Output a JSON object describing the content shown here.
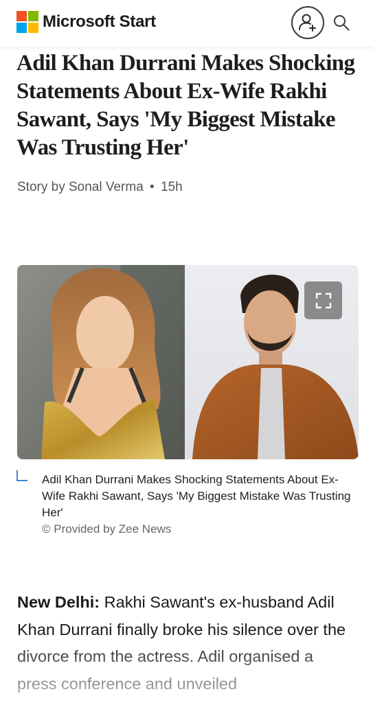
{
  "header": {
    "brand": "Microsoft Start",
    "logo_colors": [
      "#f25022",
      "#7fba00",
      "#00a4ef",
      "#ffb900"
    ],
    "account_icon": "add-account-icon",
    "search_icon": "search-icon"
  },
  "article": {
    "headline": "Adil Khan Durrani Makes Shocking Statements About Ex-Wife Rakhi Sawant, Says 'My Biggest Mistake Was Trusting Her'",
    "byline": {
      "author": "Story by Sonal Verma",
      "separator": "•",
      "age": "15h"
    },
    "image": {
      "expand_icon": "expand-icon"
    },
    "caption": "Adil Khan Durrani Makes Shocking Statements About Ex-Wife Rakhi Sawant, Says 'My Biggest Mistake Was Trusting Her'",
    "provider": "© Provided by Zee News",
    "body": {
      "dateline": "New Delhi:",
      "text": " Rakhi Sawant's ex-husband Adil Khan Durrani finally broke his silence over the divorce from the actress. Adil organised a press conference and unveiled"
    }
  }
}
